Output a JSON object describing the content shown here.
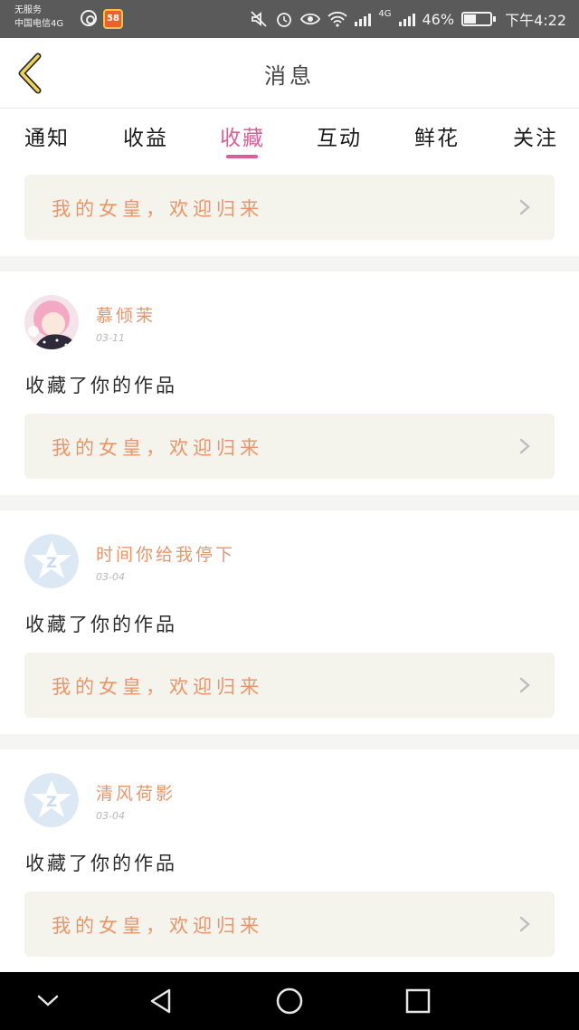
{
  "status_bar": {
    "carrier_line1": "无服务",
    "carrier_line2": "中国电信4G",
    "app_badge": "58",
    "network": "4G",
    "battery_percent": "46%",
    "battery_level": 0.46,
    "time": "下午4:22"
  },
  "header": {
    "title": "消息"
  },
  "tabs": [
    {
      "label": "通知"
    },
    {
      "label": "收益"
    },
    {
      "label": "收藏"
    },
    {
      "label": "互动"
    },
    {
      "label": "鲜花"
    },
    {
      "label": "关注"
    }
  ],
  "active_tab": "收藏",
  "top_banner": {
    "text": "我的女皇，欢迎归来"
  },
  "messages": [
    {
      "username": "慕倾茉",
      "date": "03-11",
      "action": "收藏了你的作品",
      "banner": "我的女皇，欢迎归来",
      "avatar": "anime-avatar"
    },
    {
      "username": "时间你给我停下",
      "date": "03-04",
      "action": "收藏了你的作品",
      "banner": "我的女皇，欢迎归来",
      "avatar": "default-qzone-avatar"
    },
    {
      "username": "清风荷影",
      "date": "03-04",
      "action": "收藏了你的作品",
      "banner": "我的女皇，欢迎归来",
      "avatar": "default-qzone-avatar"
    }
  ],
  "colors": {
    "accent": "#d9609a",
    "username": "#e8956a",
    "banner_bg": "#f4f3ec",
    "status_bar": "#5a5a5a"
  }
}
